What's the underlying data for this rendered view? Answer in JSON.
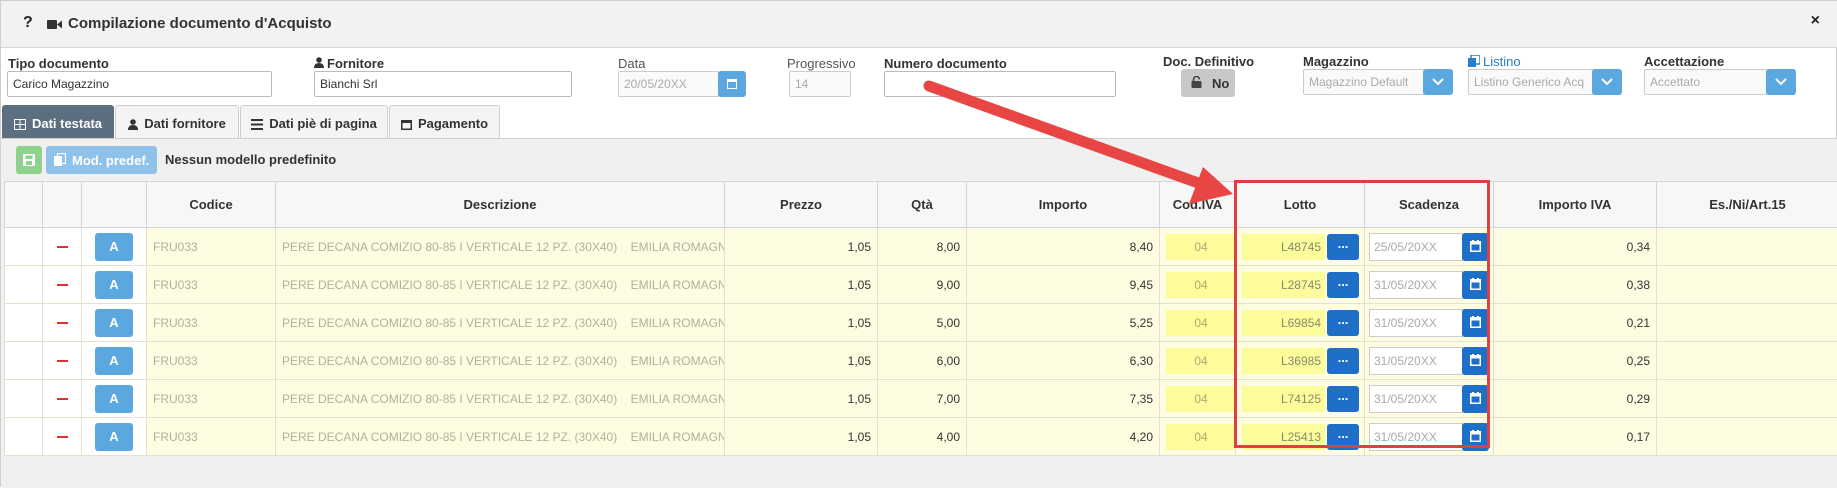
{
  "window": {
    "help": "?",
    "title": "Compilazione documento d'Acquisto",
    "close": "×"
  },
  "form": {
    "tipo_documento": {
      "label": "Tipo documento",
      "value": "Carico Magazzino"
    },
    "fornitore": {
      "label": "Fornitore",
      "value": "Bianchi Srl"
    },
    "data": {
      "label": "Data",
      "value": "20/05/20XX"
    },
    "progressivo": {
      "label": "Progressivo",
      "value": "14"
    },
    "numero_documento": {
      "label": "Numero documento",
      "value": ""
    },
    "doc_definitivo": {
      "label": "Doc. Definitivo",
      "value": "No"
    },
    "magazzino": {
      "label": "Magazzino",
      "value": "Magazzino Default"
    },
    "listino": {
      "label": "Listino",
      "value": "Listino Generico Acq"
    },
    "accettazione": {
      "label": "Accettazione",
      "value": "Accettato"
    }
  },
  "tabs": [
    {
      "label": "Dati testata",
      "active": true
    },
    {
      "label": "Dati fornitore",
      "active": false
    },
    {
      "label": "Dati piè di pagina",
      "active": false
    },
    {
      "label": "Pagamento",
      "active": false
    }
  ],
  "toolbar": {
    "mod_label": "Mod. predef.",
    "model_text": "Nessun modello predefinito"
  },
  "grid": {
    "columns": [
      "Codice",
      "Descrizione",
      "Prezzo",
      "Qtà",
      "Importo",
      "Cod.IVA",
      "Lotto",
      "Scadenza",
      "Importo IVA",
      "Es./Ni/Art.15"
    ],
    "row_button": "A",
    "lotto_button": "...",
    "rows": [
      {
        "codice": "FRU033",
        "descrizione": "PERE DECANA COMIZIO 80-85 I VERTICALE 12 PZ. (30X40)    EMILIA ROMAGNA",
        "prezzo": "1,05",
        "qta": "8,00",
        "importo": "8,40",
        "iva": "04",
        "lotto": "L48745",
        "scadenza": "25/05/20XX",
        "importo_iva": "0,34"
      },
      {
        "codice": "FRU033",
        "descrizione": "PERE DECANA COMIZIO 80-85 I VERTICALE 12 PZ. (30X40)    EMILIA ROMAGNA",
        "prezzo": "1,05",
        "qta": "9,00",
        "importo": "9,45",
        "iva": "04",
        "lotto": "L28745",
        "scadenza": "31/05/20XX",
        "importo_iva": "0,38"
      },
      {
        "codice": "FRU033",
        "descrizione": "PERE DECANA COMIZIO 80-85 I VERTICALE 12 PZ. (30X40)    EMILIA ROMAGNA",
        "prezzo": "1,05",
        "qta": "5,00",
        "importo": "5,25",
        "iva": "04",
        "lotto": "L69854",
        "scadenza": "31/05/20XX",
        "importo_iva": "0,21"
      },
      {
        "codice": "FRU033",
        "descrizione": "PERE DECANA COMIZIO 80-85 I VERTICALE 12 PZ. (30X40)    EMILIA ROMAGNA",
        "prezzo": "1,05",
        "qta": "6,00",
        "importo": "6,30",
        "iva": "04",
        "lotto": "L36985",
        "scadenza": "31/05/20XX",
        "importo_iva": "0,25"
      },
      {
        "codice": "FRU033",
        "descrizione": "PERE DECANA COMIZIO 80-85 I VERTICALE 12 PZ. (30X40)    EMILIA ROMAGNA",
        "prezzo": "1,05",
        "qta": "7,00",
        "importo": "7,35",
        "iva": "04",
        "lotto": "L74125",
        "scadenza": "31/05/20XX",
        "importo_iva": "0,29"
      },
      {
        "codice": "FRU033",
        "descrizione": "PERE DECANA COMIZIO 80-85 I VERTICALE 12 PZ. (30X40)    EMILIA ROMAGNA",
        "prezzo": "1,05",
        "qta": "4,00",
        "importo": "4,20",
        "iva": "04",
        "lotto": "L25413",
        "scadenza": "31/05/20XX",
        "importo_iva": "0,17"
      }
    ]
  },
  "icons": [
    "question-icon",
    "video-camera-icon",
    "close-icon",
    "user-icon",
    "calendar-icon",
    "lock-icon",
    "chevron-down-icon",
    "copy-icon",
    "table-icon",
    "list-icon",
    "save-icon",
    "minus-icon"
  ],
  "colors": {
    "accent_blue": "#5ba7e0",
    "dark_blue": "#1e6fc8",
    "active_tab": "#5c6f80",
    "row_yellow": "#fefde2",
    "highlight_red": "#e04040"
  }
}
